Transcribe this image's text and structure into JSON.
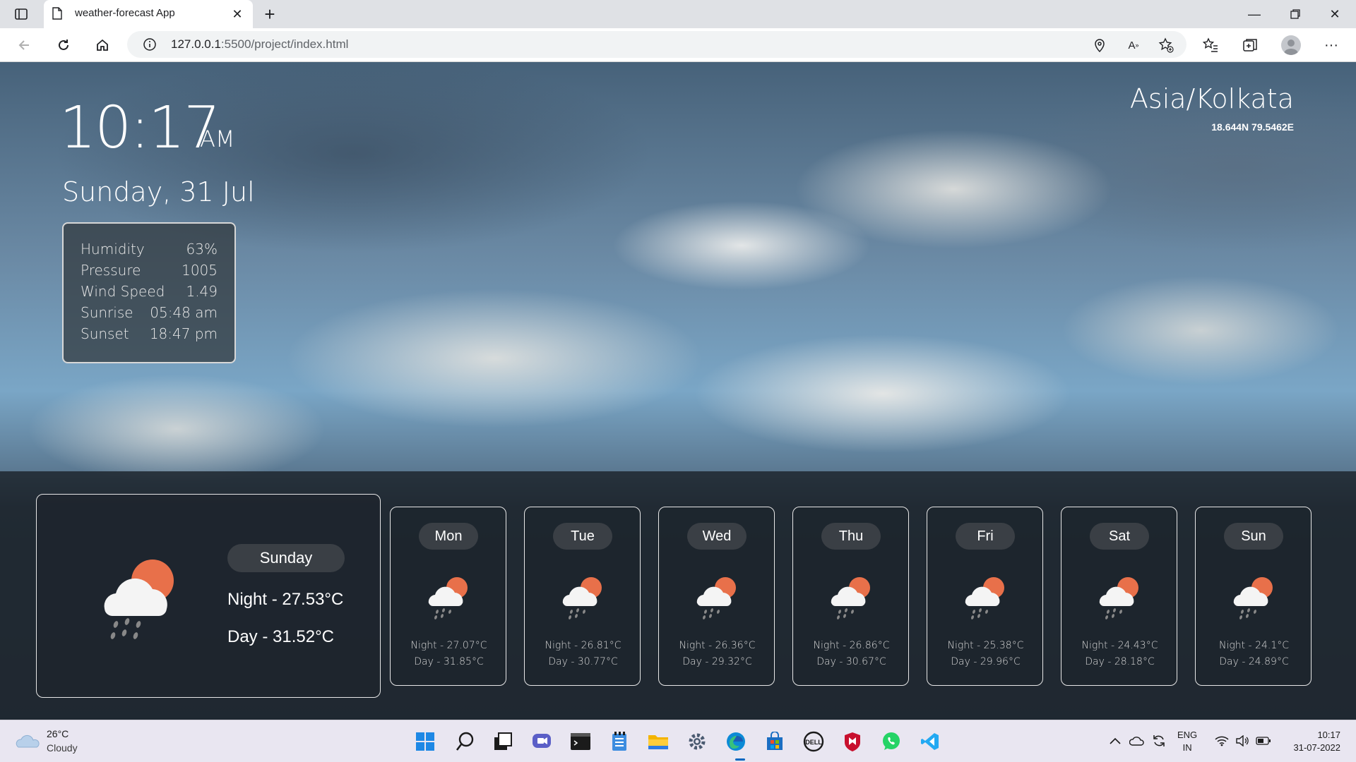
{
  "browser": {
    "tab_title": "weather-forecast App",
    "url_host": "127.0.0.1",
    "url_path": ":5500/project/index.html"
  },
  "weather": {
    "time": "10:17",
    "ampm": "AM",
    "date": "Sunday, 31 Jul",
    "timezone": "Asia/Kolkata",
    "coords": "18.644N 79.5462E",
    "stats": [
      {
        "label": "Humidity",
        "value": "63%"
      },
      {
        "label": "Pressure",
        "value": "1005"
      },
      {
        "label": "Wind Speed",
        "value": "1.49"
      },
      {
        "label": "Sunrise",
        "value": "05:48 am"
      },
      {
        "label": "Sunset",
        "value": "18:47 pm"
      }
    ],
    "today": {
      "day": "Sunday",
      "night": "Night - 27.53°C",
      "dayt": "Day - 31.52°C",
      "icon": "rain-cloud-sun-icon"
    },
    "forecast": [
      {
        "day": "Mon",
        "night": "Night - 27.07°C",
        "dayt": "Day - 31.85°C"
      },
      {
        "day": "Tue",
        "night": "Night - 26.81°C",
        "dayt": "Day - 30.77°C"
      },
      {
        "day": "Wed",
        "night": "Night - 26.36°C",
        "dayt": "Day - 29.32°C"
      },
      {
        "day": "Thu",
        "night": "Night - 26.86°C",
        "dayt": "Day - 30.67°C"
      },
      {
        "day": "Fri",
        "night": "Night - 25.38°C",
        "dayt": "Day - 29.96°C"
      },
      {
        "day": "Sat",
        "night": "Night - 24.43°C",
        "dayt": "Day - 28.18°C"
      },
      {
        "day": "Sun",
        "night": "Night - 24.1°C",
        "dayt": "Day - 24.89°C"
      }
    ]
  },
  "taskbar": {
    "temp": "26°C",
    "condition": "Cloudy",
    "lang1": "ENG",
    "lang2": "IN",
    "time": "10:17",
    "date": "31-07-2022"
  },
  "colors": {
    "sun": "#e8704a",
    "cloud": "#f4f4f4",
    "accent": "#0067c0"
  }
}
